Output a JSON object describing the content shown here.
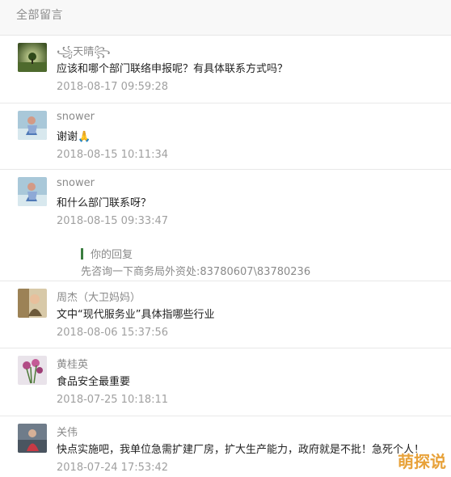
{
  "header": {
    "title": "全部留言"
  },
  "comments": [
    {
      "name": "꧁天晴꧂",
      "text": "应该和哪个部门联络申报呢？有具体联系方式吗？",
      "time": "2018-08-17 09:59:28",
      "avatar_icon": "landscape-tree-avatar"
    },
    {
      "name": "snower",
      "text": "谢谢🙏",
      "time": "2018-08-15 10:11:34",
      "avatar_icon": "person-photo-avatar"
    },
    {
      "name": "snower",
      "text": "和什么部门联系呀？",
      "time": "2018-08-15 09:33:47",
      "avatar_icon": "person-photo-avatar",
      "reply": {
        "label": "你的回复",
        "text": "先咨询一下商务局外资处:83780607\\83780236"
      }
    },
    {
      "name": "周杰（大卫妈妈）",
      "text": "文中“现代服务业”具体指哪些行业",
      "time": "2018-08-06 15:37:56",
      "avatar_icon": "child-photo-avatar"
    },
    {
      "name": "黄桂英",
      "text": "食品安全最重要",
      "time": "2018-07-25 10:18:11",
      "avatar_icon": "flowers-photo-avatar"
    },
    {
      "name": "关伟",
      "text": "快点实施吧，我单位急需扩建厂房，扩大生产能力，政府就是不批！急死个人！",
      "time": "2018-07-24 17:53:42",
      "avatar_icon": "person-photo-avatar"
    }
  ],
  "watermark": "萌探说"
}
